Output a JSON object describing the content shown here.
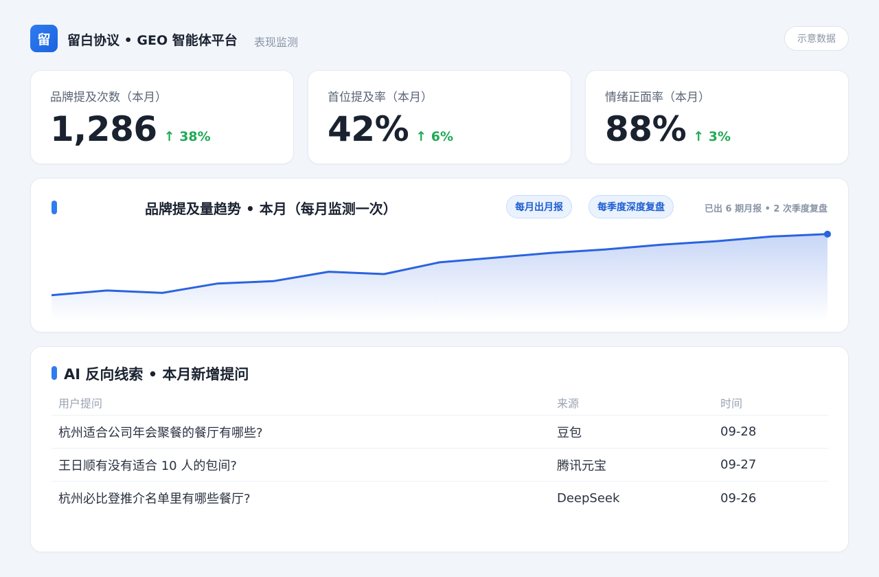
{
  "header": {
    "logo_char": "留",
    "title": "留白协议 • GEO 智能体平台",
    "subtitle": "表现监测",
    "badge": "示意数据"
  },
  "stats": [
    {
      "label": "品牌提及次数（本月）",
      "value": "1,286",
      "delta": "↑ 38%"
    },
    {
      "label": "首位提及率（本月）",
      "value": "42%",
      "delta": "↑ 6%"
    },
    {
      "label": "情绪正面率（本月）",
      "value": "88%",
      "delta": "↑ 3%"
    }
  ],
  "trend": {
    "title": "品牌提及量趋势 • 本月（每月监测一次）",
    "pill_monthly": "每月出月报",
    "pill_quarterly": "每季度深度复盘",
    "note": "已出 6 期月报 • 2 次季度复盘",
    "line_color": "#2a63de",
    "positive_color": "#1faa55"
  },
  "chart_data": {
    "type": "area",
    "title": "品牌提及量趋势 • 本月（每月监测一次）",
    "x": [
      1,
      2,
      3,
      4,
      5,
      6,
      7,
      8,
      9,
      10,
      11,
      12,
      13,
      14,
      15
    ],
    "values": [
      10,
      12,
      11,
      15,
      16,
      20,
      19,
      24,
      26,
      28,
      29.5,
      31.5,
      33,
      35,
      36
    ],
    "ylim": [
      0,
      38
    ],
    "grid": false,
    "marker_last": true
  },
  "leads": {
    "title": "AI 反向线索 • 本月新增提问",
    "columns": [
      "用户提问",
      "来源",
      "时间"
    ],
    "rows": [
      {
        "question": "杭州适合公司年会聚餐的餐厅有哪些?",
        "source": "豆包",
        "time": "09-28"
      },
      {
        "question": "王日顺有没有适合 10 人的包间?",
        "source": "腾讯元宝",
        "time": "09-27"
      },
      {
        "question": "杭州必比登推介名单里有哪些餐厅?",
        "source": "DeepSeek",
        "time": "09-26"
      }
    ]
  }
}
